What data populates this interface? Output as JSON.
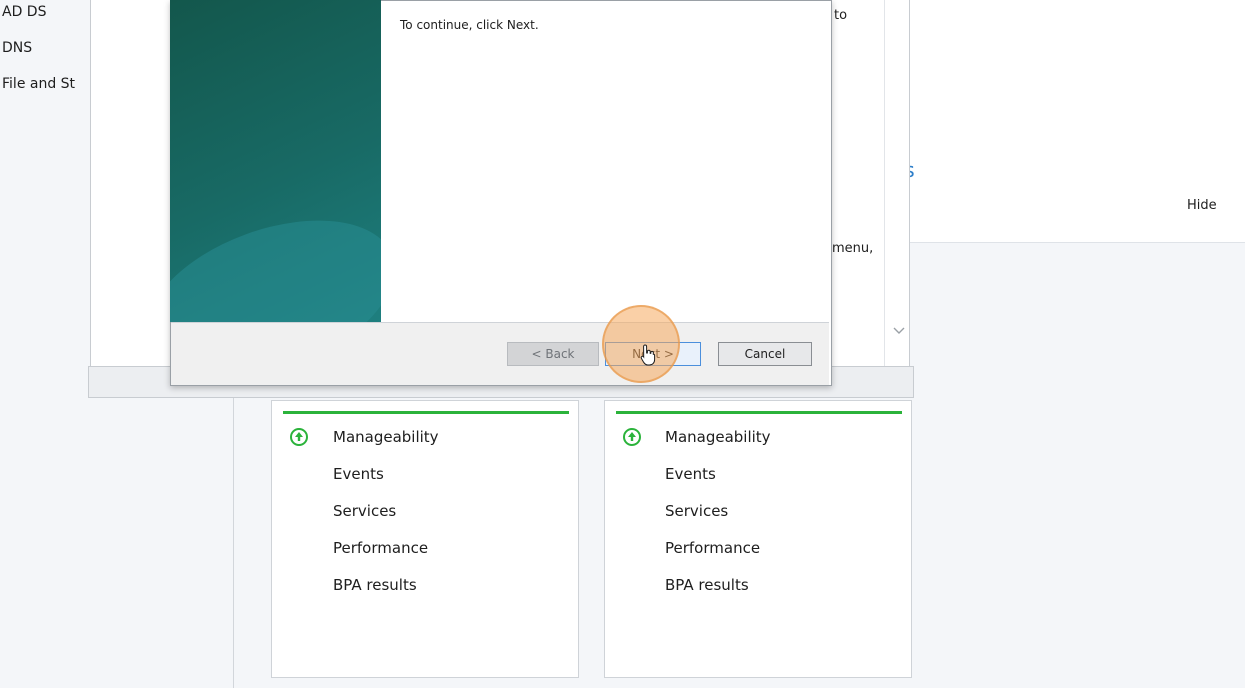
{
  "left_nav": {
    "items": [
      {
        "label": "AD DS"
      },
      {
        "label": "DNS"
      },
      {
        "label": "File and St"
      }
    ]
  },
  "welcome_panel": {
    "title_fragment": "es",
    "hide_label": "Hide"
  },
  "host_window": {
    "text_fragment_1": "to",
    "text_fragment_2": "menu,"
  },
  "dialog": {
    "continue_text": "To continue, click Next.",
    "back_button": "< Back",
    "next_button": "Next >",
    "cancel_button": "Cancel"
  },
  "tiles": [
    {
      "heading": "Manageability",
      "items": [
        "Events",
        "Services",
        "Performance",
        "BPA results"
      ]
    },
    {
      "heading": "Manageability",
      "items": [
        "Events",
        "Services",
        "Performance",
        "BPA results"
      ]
    }
  ],
  "colors": {
    "status_green": "#2bb33b",
    "accent_blue": "#2d7ec9",
    "banner_teal": "#186a65"
  },
  "icons": {
    "status": "up-arrow-circle-icon",
    "cursor": "hand-pointer-icon",
    "scroll": "chevron-down-icon"
  }
}
